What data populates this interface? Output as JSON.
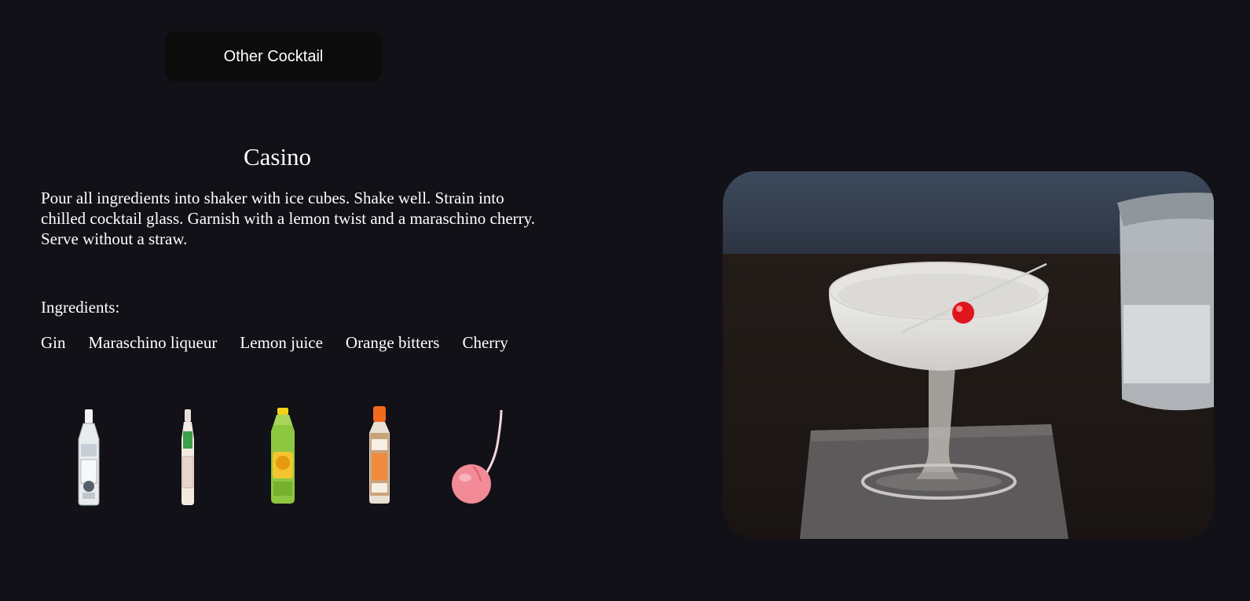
{
  "actions": {
    "other_cocktail_label": "Other Cocktail"
  },
  "cocktail": {
    "name": "Casino",
    "instructions": "Pour all ingredients into shaker with ice cubes. Shake well. Strain into chilled cocktail glass. Garnish with a lemon twist and a maraschino cherry. Serve without a straw.",
    "ingredients_heading": "Ingredients:",
    "ingredients": [
      {
        "name": "Gin",
        "icon": "gin-bottle-icon"
      },
      {
        "name": "Maraschino liqueur",
        "icon": "liqueur-bottle-icon"
      },
      {
        "name": "Lemon juice",
        "icon": "lemon-juice-bottle-icon"
      },
      {
        "name": "Orange bitters",
        "icon": "bitters-bottle-icon"
      },
      {
        "name": "Cherry",
        "icon": "cherry-icon"
      }
    ],
    "photo": "cocktail-photo"
  },
  "colors": {
    "background": "#121117",
    "button_bg": "#0c0c0c",
    "text": "#ffffff"
  }
}
